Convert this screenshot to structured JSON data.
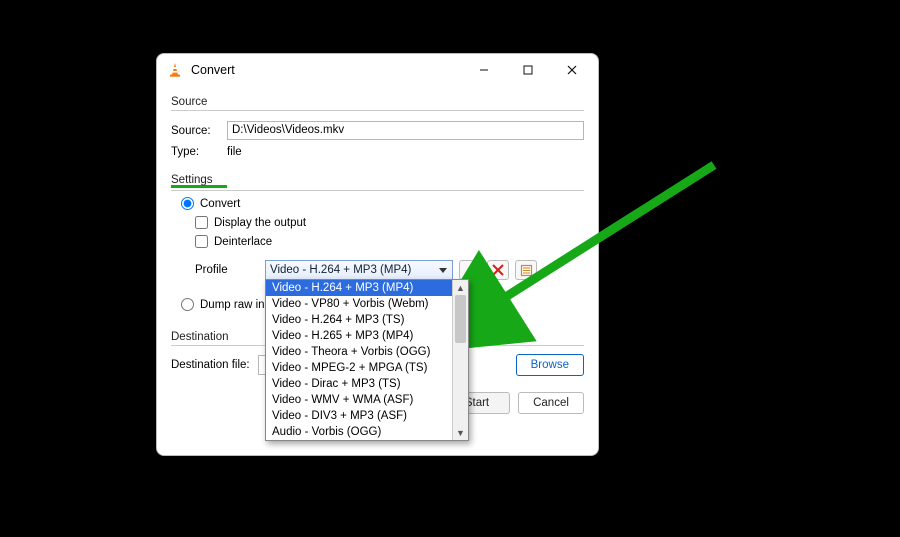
{
  "window": {
    "title": "Convert"
  },
  "source": {
    "group_label": "Source",
    "source_label": "Source:",
    "source_value": "D:\\Videos\\Videos.mkv",
    "type_label": "Type:",
    "type_value": "file"
  },
  "settings": {
    "group_label": "Settings",
    "convert_label": "Convert",
    "display_output_label": "Display the output",
    "deinterlace_label": "Deinterlace",
    "profile_label": "Profile",
    "profile_selected": "Video - H.264 + MP3 (MP4)",
    "profile_options": [
      "Video - H.264 + MP3 (MP4)",
      "Video - VP80 + Vorbis (Webm)",
      "Video - H.264 + MP3 (TS)",
      "Video - H.265 + MP3 (MP4)",
      "Video - Theora + Vorbis (OGG)",
      "Video - MPEG-2 + MPGA (TS)",
      "Video - Dirac + MP3 (TS)",
      "Video - WMV + WMA (ASF)",
      "Video - DIV3 + MP3 (ASF)",
      "Audio - Vorbis (OGG)"
    ],
    "dump_raw_label": "Dump raw input"
  },
  "destination": {
    "group_label": "Destination",
    "file_label": "Destination file:",
    "browse_label": "Browse"
  },
  "footer": {
    "start_label": "Start",
    "cancel_label": "Cancel"
  },
  "icons": {
    "wrench": "wrench-icon",
    "delete": "delete-icon",
    "new": "new-profile-icon"
  }
}
